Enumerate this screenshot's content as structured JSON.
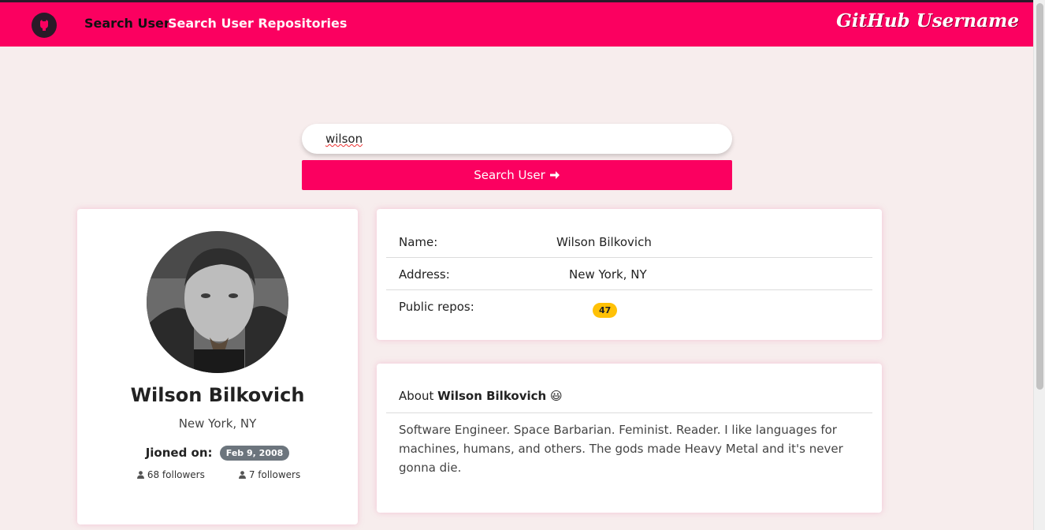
{
  "navbar": {
    "links": [
      {
        "label": "Search User",
        "active": true
      },
      {
        "label": "Search User Repositories",
        "active": false
      }
    ],
    "brand": "GitHub Username",
    "accent_color": "#fb0060"
  },
  "search": {
    "value": "wilson",
    "button_label": "Search User",
    "button_icon": "arrow-right-icon"
  },
  "profile": {
    "name": "Wilson Bilkovich",
    "location": "New York, NY",
    "joined_label": "Jioned on:",
    "joined_date": "Feb 9, 2008",
    "followers_label": "68 followers",
    "following_label": "7 followers"
  },
  "details": {
    "rows": [
      {
        "label": "Name:",
        "value": "Wilson Bilkovich"
      },
      {
        "label": "Address:",
        "value": "New York, NY"
      },
      {
        "label": "Public repos:",
        "value": "47"
      }
    ]
  },
  "about": {
    "prefix": "About",
    "name": "Wilson Bilkovich",
    "emoji": "😃",
    "text": "Software Engineer. Space Barbarian. Feminist. Reader. I like languages for machines, humans, and others. The gods made Heavy Metal and it's never gonna die."
  }
}
